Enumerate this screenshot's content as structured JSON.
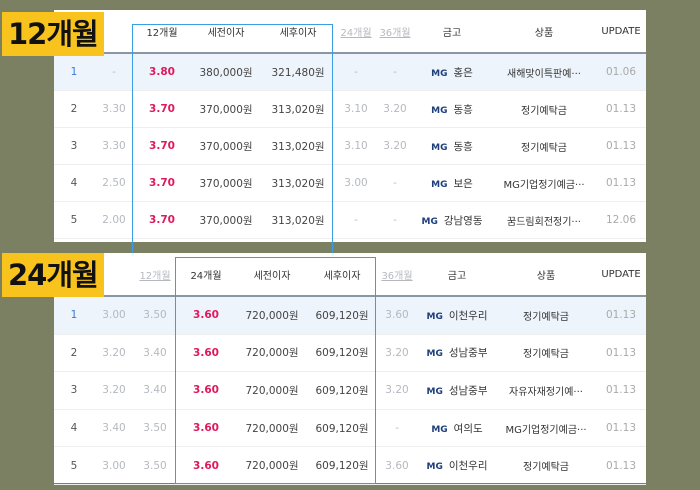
{
  "section1": {
    "badge": "12개월",
    "headers": [
      "",
      "",
      "12개월",
      "세전이자",
      "세후이자",
      "24개월",
      "36개월",
      "금고",
      "상품",
      "UPDATE"
    ],
    "rows": [
      [
        "1",
        "-",
        "3.80",
        "380,000원",
        "321,480원",
        "-",
        "-",
        "홍은",
        "새해맞이특판예···",
        "01.06"
      ],
      [
        "2",
        "3.30",
        "3.70",
        "370,000원",
        "313,020원",
        "3.10",
        "3.20",
        "동흥",
        "정기예탁금",
        "01.13"
      ],
      [
        "3",
        "3.30",
        "3.70",
        "370,000원",
        "313,020원",
        "3.10",
        "3.20",
        "동흥",
        "정기예탁금",
        "01.13"
      ],
      [
        "4",
        "2.50",
        "3.70",
        "370,000원",
        "313,020원",
        "3.00",
        "-",
        "보은",
        "MG기업정기예금···",
        "01.13"
      ],
      [
        "5",
        "2.00",
        "3.70",
        "370,000원",
        "313,020원",
        "-",
        "-",
        "강남영동",
        "꿈드림회전정기···",
        "12.06"
      ]
    ]
  },
  "section2": {
    "badge": "24개월",
    "headers": [
      "",
      "",
      "12개월",
      "24개월",
      "세전이자",
      "세후이자",
      "36개월",
      "금고",
      "상품",
      "UPDATE"
    ],
    "rows": [
      [
        "1",
        "3.00",
        "3.50",
        "3.60",
        "720,000원",
        "609,120원",
        "3.60",
        "이천우리",
        "정기예탁금",
        "01.13"
      ],
      [
        "2",
        "3.20",
        "3.40",
        "3.60",
        "720,000원",
        "609,120원",
        "3.20",
        "성남중부",
        "정기예탁금",
        "01.13"
      ],
      [
        "3",
        "3.20",
        "3.40",
        "3.60",
        "720,000원",
        "609,120원",
        "3.20",
        "성남중부",
        "자유자재정기예···",
        "01.13"
      ],
      [
        "4",
        "3.40",
        "3.50",
        "3.60",
        "720,000원",
        "609,120원",
        "-",
        "여의도",
        "MG기업정기예금···",
        "01.13"
      ],
      [
        "5",
        "3.00",
        "3.50",
        "3.60",
        "720,000원",
        "609,120원",
        "3.60",
        "이천우리",
        "정기예탁금",
        "01.13"
      ]
    ]
  },
  "bank_logo": "MG"
}
